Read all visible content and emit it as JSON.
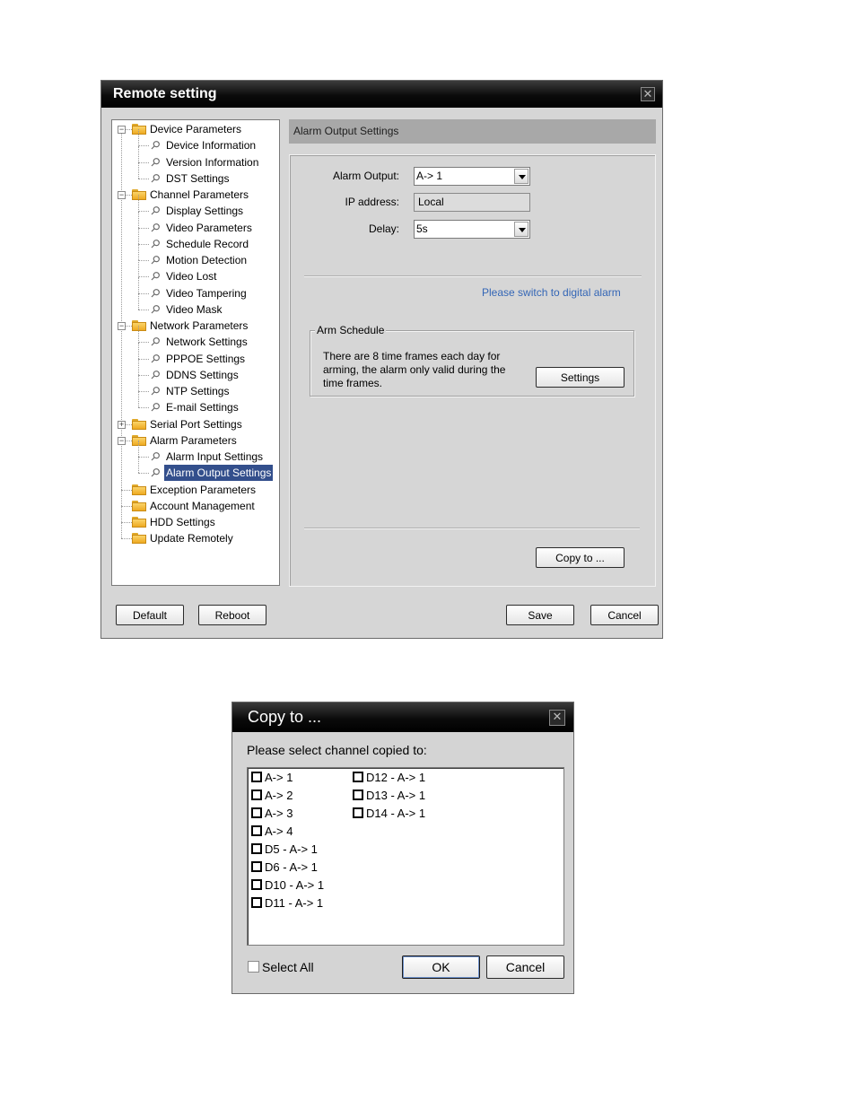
{
  "remote_setting": {
    "title": "Remote setting",
    "tree": [
      {
        "label": "Device Parameters",
        "type": "folder",
        "level": 0,
        "expander": "−"
      },
      {
        "label": "Device Information",
        "type": "leaf",
        "level": 1
      },
      {
        "label": "Version Information",
        "type": "leaf",
        "level": 1
      },
      {
        "label": "DST Settings",
        "type": "leaf",
        "level": 1
      },
      {
        "label": "Channel Parameters",
        "type": "folder",
        "level": 0,
        "expander": "−"
      },
      {
        "label": "Display Settings",
        "type": "leaf",
        "level": 1
      },
      {
        "label": "Video Parameters",
        "type": "leaf",
        "level": 1
      },
      {
        "label": "Schedule Record",
        "type": "leaf",
        "level": 1
      },
      {
        "label": "Motion Detection",
        "type": "leaf",
        "level": 1
      },
      {
        "label": "Video Lost",
        "type": "leaf",
        "level": 1
      },
      {
        "label": "Video Tampering",
        "type": "leaf",
        "level": 1
      },
      {
        "label": "Video Mask",
        "type": "leaf",
        "level": 1
      },
      {
        "label": "Network Parameters",
        "type": "folder",
        "level": 0,
        "expander": "−"
      },
      {
        "label": "Network Settings",
        "type": "leaf",
        "level": 1
      },
      {
        "label": "PPPOE Settings",
        "type": "leaf",
        "level": 1
      },
      {
        "label": "DDNS Settings",
        "type": "leaf",
        "level": 1
      },
      {
        "label": "NTP Settings",
        "type": "leaf",
        "level": 1
      },
      {
        "label": "E-mail Settings",
        "type": "leaf",
        "level": 1
      },
      {
        "label": "Serial Port Settings",
        "type": "folder",
        "level": 0,
        "expander": "+"
      },
      {
        "label": "Alarm Parameters",
        "type": "folder",
        "level": 0,
        "expander": "−"
      },
      {
        "label": "Alarm Input Settings",
        "type": "leaf",
        "level": 1
      },
      {
        "label": "Alarm Output Settings",
        "type": "leaf",
        "level": 1,
        "selected": true
      },
      {
        "label": "Exception Parameters",
        "type": "folder",
        "level": 0
      },
      {
        "label": "Account Management",
        "type": "folder",
        "level": 0
      },
      {
        "label": "HDD Settings",
        "type": "folder",
        "level": 0
      },
      {
        "label": "Update Remotely",
        "type": "folder",
        "level": 0
      }
    ],
    "panel": {
      "header": "Alarm Output Settings",
      "alarm_output_label": "Alarm Output:",
      "alarm_output_value": "A-> 1",
      "ip_label": "IP address:",
      "ip_value": "Local",
      "delay_label": "Delay:",
      "delay_value": "5s",
      "digital_alarm_link": "Please switch to digital alarm",
      "arm_schedule_title": "Arm Schedule",
      "arm_schedule_text_1": "There are 8 time frames each day for",
      "arm_schedule_text_2": "arming, the alarm only valid during the",
      "arm_schedule_text_3": "time frames.",
      "settings_button": "Settings",
      "copy_to_button": "Copy to ..."
    },
    "footer": {
      "default_button": "Default",
      "reboot_button": "Reboot",
      "save_button": "Save",
      "cancel_button": "Cancel"
    }
  },
  "copy_to": {
    "title": "Copy to ...",
    "prompt": "Please select channel copied to:",
    "channels_col1": [
      "A-> 1",
      "A-> 2",
      "A-> 3",
      "A-> 4",
      "D5 - A-> 1",
      "D6 - A-> 1",
      "D10 - A-> 1",
      "D11 - A-> 1"
    ],
    "channels_col2": [
      "D12 - A-> 1",
      "D13 - A-> 1",
      "D14 - A-> 1"
    ],
    "select_all_label": "Select All",
    "ok_button": "OK",
    "cancel_button": "Cancel"
  }
}
